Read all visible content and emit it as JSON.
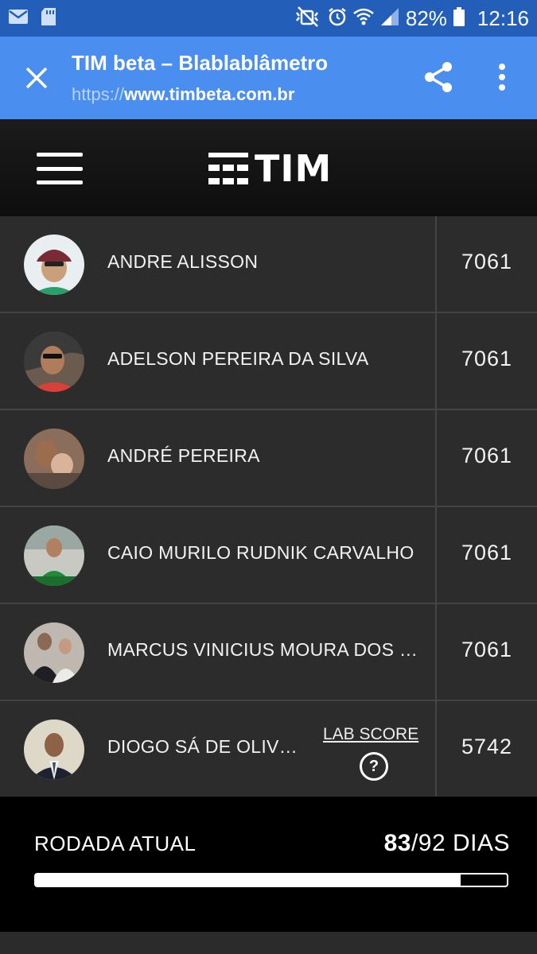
{
  "status_bar": {
    "battery": "82%",
    "time": "12:16",
    "icons": [
      "email-icon",
      "sd-card-icon",
      "mute-icon",
      "alarm-icon",
      "wifi-icon",
      "signal-icon",
      "battery-icon"
    ]
  },
  "browser": {
    "title": "TIM beta – Blablablâmetro",
    "url_scheme": "https://",
    "url_host": "www.timbeta.com.br"
  },
  "header": {
    "logo_text": "TIM"
  },
  "ranking": [
    {
      "name": "ANDRE ALISSON",
      "score": "7061"
    },
    {
      "name": "ADELSON PEREIRA DA SILVA",
      "score": "7061"
    },
    {
      "name": "ANDRÉ PEREIRA",
      "score": "7061"
    },
    {
      "name": "CAIO MURILO RUDNIK CARVALHO",
      "score": "7061"
    },
    {
      "name": "MARCUS VINICIUS MOURA DOS SANTOS",
      "score": "7061"
    },
    {
      "name": "DIOGO SÁ DE OLIVEIRA",
      "score": "5742",
      "lab_score_label": "LAB SCORE",
      "help_symbol": "?"
    }
  ],
  "footer": {
    "label": "RODADA ATUAL",
    "current_day": "83",
    "total_days_text": "/92 DIAS",
    "progress_fraction": 0.902
  },
  "colors": {
    "status_bar": "#235fb9",
    "tab_bar": "#4a8ef0",
    "background": "#2c2c2c"
  }
}
